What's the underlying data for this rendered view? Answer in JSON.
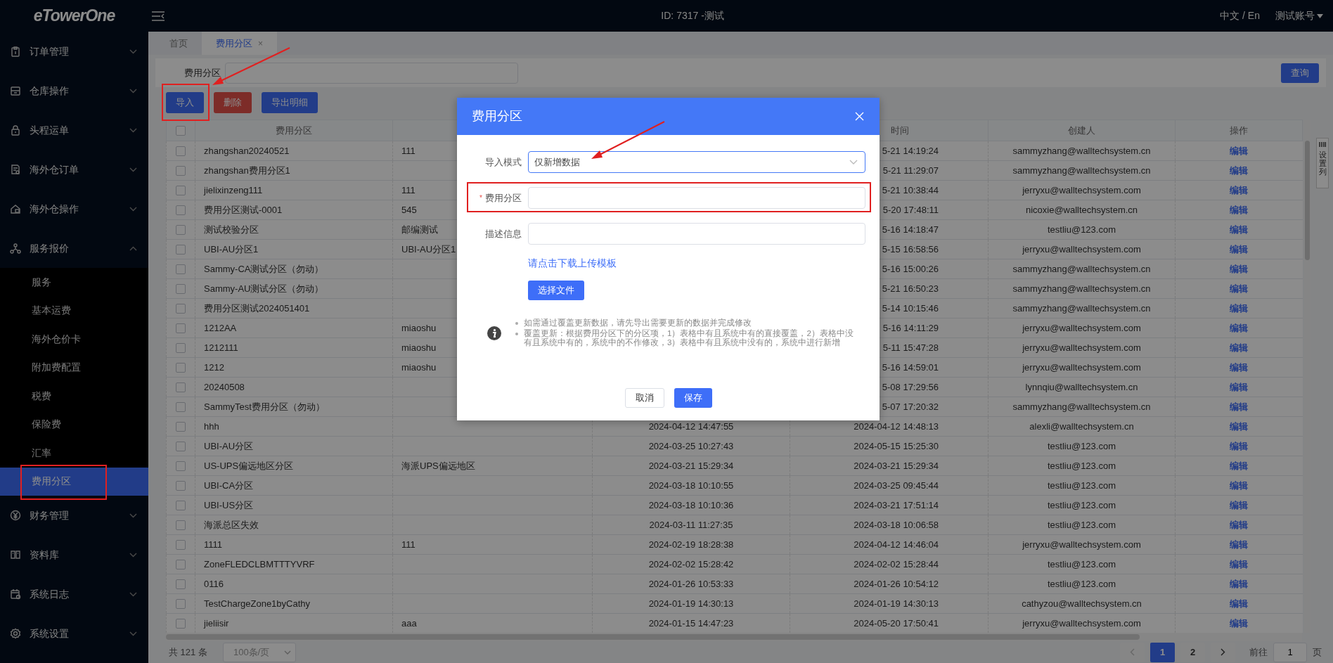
{
  "topbar": {
    "logo": "eTowerOne",
    "title": "ID: 7317 -测试",
    "language": "中文 / En",
    "account": "测试账号"
  },
  "sidebar": {
    "items": [
      {
        "label": "订单管理",
        "expanded": false
      },
      {
        "label": "仓库操作",
        "expanded": false
      },
      {
        "label": "头程运单",
        "expanded": false
      },
      {
        "label": "海外仓订单",
        "expanded": false
      },
      {
        "label": "海外仓操作",
        "expanded": false
      },
      {
        "label": "服务报价",
        "expanded": true,
        "children": [
          {
            "label": "服务",
            "selected": false
          },
          {
            "label": "基本运费",
            "selected": false
          },
          {
            "label": "海外仓价卡",
            "selected": false
          },
          {
            "label": "附加费配置",
            "selected": false
          },
          {
            "label": "税费",
            "selected": false
          },
          {
            "label": "保险费",
            "selected": false
          },
          {
            "label": "汇率",
            "selected": false
          },
          {
            "label": "费用分区",
            "selected": true,
            "annotated": true
          }
        ]
      },
      {
        "label": "财务管理",
        "expanded": false
      },
      {
        "label": "资料库",
        "expanded": false
      },
      {
        "label": "系统日志",
        "expanded": false
      },
      {
        "label": "系统设置",
        "expanded": false
      }
    ]
  },
  "tabs": [
    {
      "label": "首页",
      "selected": false
    },
    {
      "label": "费用分区",
      "selected": true,
      "close": "×"
    }
  ],
  "filter": {
    "label": "费用分区",
    "search_button": "查询"
  },
  "toolbar": {
    "buttons": [
      {
        "label": "导入",
        "kind": "primary",
        "annotated": true
      },
      {
        "label": "删除",
        "kind": "danger",
        "annotated": false
      },
      {
        "label": "导出明细",
        "kind": "primary",
        "annotated": false
      }
    ]
  },
  "table": {
    "columns": [
      {
        "label": "费用分区"
      },
      {},
      {},
      {
        "label": "时间"
      },
      {
        "label": "创建人"
      },
      {
        "label": "操作"
      }
    ],
    "header_checked": false,
    "rows": [
      {
        "checked": false,
        "zone": "zhangshan20240521",
        "description": "111",
        "modified": "5-21 14:19:24",
        "creator": "sammyzhang@walltechsystem.cn",
        "action": "编辑"
      },
      {
        "checked": false,
        "zone": "zhangshan费用分区1",
        "modified": "5-21 11:29:07",
        "creator": "sammyzhang@walltechsystem.cn",
        "action": "编辑"
      },
      {
        "checked": false,
        "zone": "jielixinzeng111",
        "description": "111",
        "modified": "5-21 10:38:44",
        "creator": "jerryxu@walltechsystem.com",
        "action": "编辑"
      },
      {
        "checked": false,
        "zone": "费用分区测试-0001",
        "description": "545",
        "modified": "5-20 17:48:11",
        "creator": "nicoxie@walltechsystem.cn",
        "action": "编辑"
      },
      {
        "checked": false,
        "zone": "测试校验分区",
        "description": "邮编测试",
        "modified": "5-16 14:18:47",
        "creator": "testliu@123.com",
        "action": "编辑"
      },
      {
        "checked": false,
        "zone": "UBI-AU分区1",
        "description": "UBI-AU分区1",
        "modified": "5-15 16:58:56",
        "creator": "jerryxu@walltechsystem.com",
        "action": "编辑"
      },
      {
        "checked": false,
        "zone": "Sammy-CA测试分区（勿动）",
        "modified": "5-16 15:00:26",
        "creator": "sammyzhang@walltechsystem.cn",
        "action": "编辑"
      },
      {
        "checked": false,
        "zone": "Sammy-AU测试分区（勿动）",
        "modified": "5-21 16:50:23",
        "creator": "sammyzhang@walltechsystem.cn",
        "action": "编辑"
      },
      {
        "checked": false,
        "zone": "费用分区测试2024051401",
        "modified": "5-14 10:15:46",
        "creator": "sammyzhang@walltechsystem.cn",
        "action": "编辑"
      },
      {
        "checked": false,
        "zone": "1212AA",
        "description": "miaoshu",
        "modified": "5-16 14:11:29",
        "creator": "jerryxu@walltechsystem.com",
        "action": "编辑"
      },
      {
        "checked": false,
        "zone": "1212111",
        "description": "miaoshu",
        "modified": "5-11 15:47:28",
        "creator": "jerryxu@walltechsystem.com",
        "action": "编辑"
      },
      {
        "checked": false,
        "zone": "1212",
        "description": "miaoshu",
        "modified": "5-16 14:59:01",
        "creator": "jerryxu@walltechsystem.com",
        "action": "编辑"
      },
      {
        "checked": false,
        "zone": "20240508",
        "modified": "5-08 17:29:56",
        "creator": "lynnqiu@walltechsystem.cn",
        "action": "编辑"
      },
      {
        "checked": false,
        "zone": "SammyTest费用分区（勿动）",
        "modified": "5-07 17:20:32",
        "creator": "sammyzhang@walltechsystem.cn",
        "action": "编辑"
      },
      {
        "checked": false,
        "zone": "hhh",
        "created": "2024-04-12 14:47:55",
        "modified": "2024-04-12 14:48:13",
        "creator": "alexli@walltechsystem.cn",
        "action": "编辑"
      },
      {
        "checked": false,
        "zone": "UBI-AU分区",
        "created": "2024-03-25 10:27:43",
        "modified": "2024-05-15 15:25:30",
        "creator": "testliu@123.com",
        "action": "编辑"
      },
      {
        "checked": false,
        "zone": "US-UPS偏远地区分区",
        "description": "海派UPS偏远地区",
        "created": "2024-03-21 15:29:34",
        "modified": "2024-03-21 15:29:34",
        "creator": "testliu@123.com",
        "action": "编辑"
      },
      {
        "checked": false,
        "zone": "UBI-CA分区",
        "created": "2024-03-18 10:10:55",
        "modified": "2024-03-25 09:45:44",
        "creator": "testliu@123.com",
        "action": "编辑"
      },
      {
        "checked": false,
        "zone": "UBI-US分区",
        "created": "2024-03-18 10:10:36",
        "modified": "2024-03-21 17:51:14",
        "creator": "testliu@123.com",
        "action": "编辑"
      },
      {
        "checked": false,
        "zone": "海派总区失效",
        "created": "2024-03-11 11:27:35",
        "modified": "2024-03-18 10:06:58",
        "creator": "testliu@123.com",
        "action": "编辑"
      },
      {
        "checked": false,
        "zone": "1111",
        "description": "111",
        "created": "2024-02-19 18:28:38",
        "modified": "2024-04-12 14:46:04",
        "creator": "jerryxu@walltechsystem.com",
        "action": "编辑"
      },
      {
        "checked": false,
        "zone": "ZoneFLEDCLBMTTTYVRF",
        "created": "2024-02-02 15:28:42",
        "modified": "2024-02-02 15:28:44",
        "creator": "testliu@123.com",
        "action": "编辑"
      },
      {
        "checked": false,
        "zone": "0116",
        "created": "2024-01-26 10:53:33",
        "modified": "2024-01-26 10:54:12",
        "creator": "testliu@123.com",
        "action": "编辑"
      },
      {
        "checked": false,
        "zone": "TestChargeZone1byCathy",
        "created": "2024-01-19 14:30:13",
        "modified": "2024-01-19 14:30:13",
        "creator": "cathyzou@walltechsystem.cn",
        "action": "编辑"
      },
      {
        "checked": false,
        "zone": "jieliisir",
        "description": "aaa",
        "created": "2024-01-15 14:47:23",
        "modified": "2024-05-20 17:50:41",
        "creator": "jerryxu@walltechsystem.com",
        "action": "编辑"
      }
    ]
  },
  "column_settings": "设置列",
  "pagination": {
    "total": "共 121 条",
    "page_size": "100条/页",
    "pages": [
      {
        "label": "1",
        "selected": true
      },
      {
        "label": "2",
        "selected": false
      }
    ],
    "goto_label": "前往",
    "goto_value": "1",
    "page_suffix": "页"
  },
  "dialog": {
    "title": "费用分区",
    "fields": [
      {
        "label": "导入模式",
        "kind": "select",
        "value": "仅新增数据",
        "annotated": false
      },
      {
        "label": "费用分区",
        "kind": "text",
        "marker": "*",
        "annotated": true
      },
      {
        "label": "描述信息",
        "kind": "text",
        "annotated": false
      }
    ],
    "template_link": "请点击下载上传模板",
    "file_button": "选择文件",
    "notes": [
      "如需通过覆盖更新数据，请先导出需要更新的数据并完成修改",
      "覆盖更新：根据费用分区下的分区项，1）表格中有且系统中有的直接覆盖，2）表格中没有且系统中有的，系统中的不作修改，3）表格中有且系统中没有的，系统中进行新增"
    ],
    "buttons": [
      {
        "label": "取消",
        "kind": "secondary"
      },
      {
        "label": "保存",
        "kind": "primary"
      }
    ]
  }
}
